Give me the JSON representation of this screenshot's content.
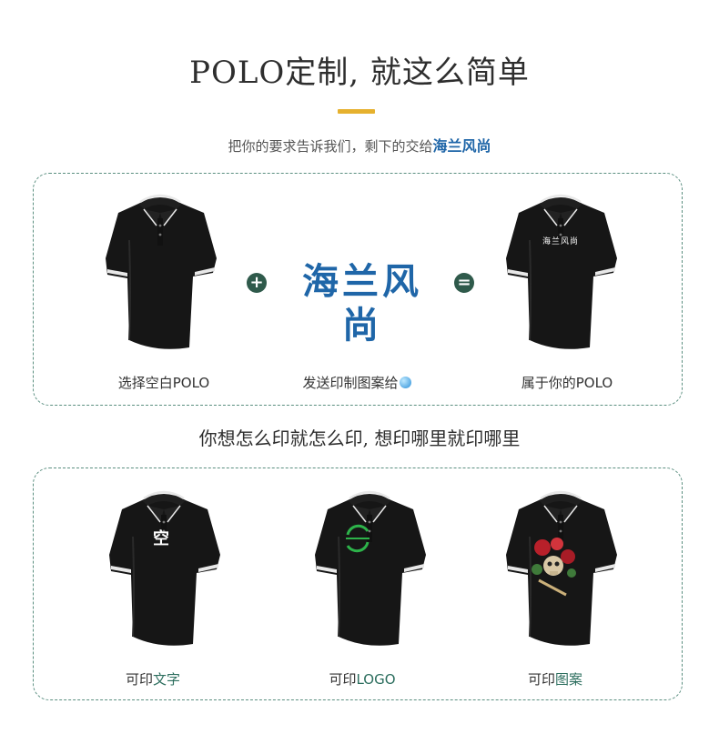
{
  "header": {
    "title": "POLO定制, 就这么简单",
    "subtitle_prefix": "把你的要求告诉我们，剩下的交给",
    "subtitle_brand": "海兰风尚"
  },
  "step_panel": {
    "brand_logo": "海兰风尚",
    "plus_symbol": "+",
    "equals_symbol": "=",
    "steps": [
      {
        "caption": "选择空白POLO"
      },
      {
        "caption": "发送印制图案给"
      },
      {
        "caption": "属于你的POLO",
        "chest_print": "海兰风尚"
      }
    ]
  },
  "slogan": "你想怎么印就怎么印, 想印哪里就印哪里",
  "print_panel": {
    "items": [
      {
        "caption_prefix": "可印",
        "caption_highlight": "文字",
        "chest_print": "空"
      },
      {
        "caption_prefix": "可印",
        "caption_highlight": "LOGO"
      },
      {
        "caption_prefix": "可印",
        "caption_highlight": "图案"
      }
    ]
  },
  "colors": {
    "accent_bar": "#e6b12e",
    "brand_blue": "#1f66a8",
    "panel_border": "#5b8f80",
    "operator_bg": "#2f5a4b",
    "logo_green": "#2db34a"
  }
}
